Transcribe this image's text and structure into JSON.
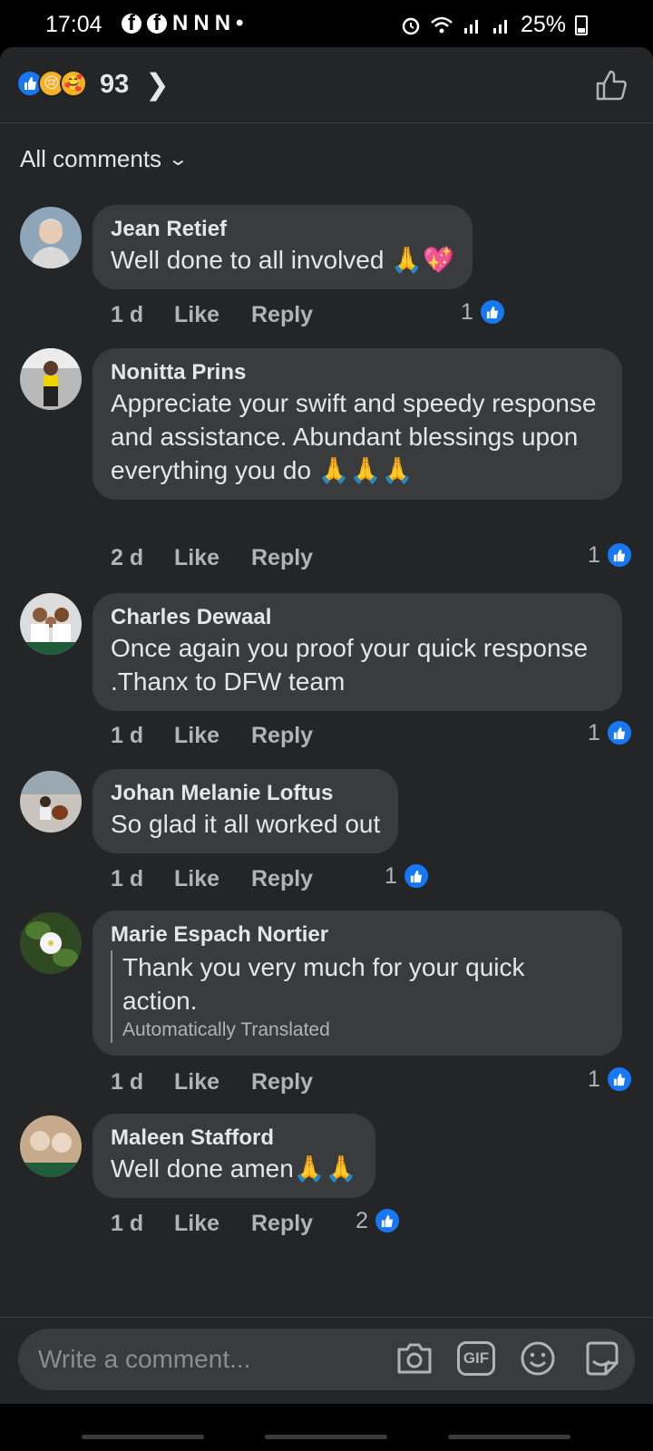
{
  "status_bar": {
    "time": "17:04",
    "notifications": [
      "f",
      "f",
      "N",
      "N",
      "N",
      "•"
    ],
    "battery": "25%"
  },
  "reactions": {
    "count": "93",
    "types": [
      "like-icon",
      "sad-icon",
      "care-icon"
    ]
  },
  "sort": {
    "label": "All comments"
  },
  "comments": [
    {
      "name": "Jean Retief",
      "text": "Well done to all involved 🙏💖",
      "time": "1 d",
      "like": "Like",
      "reply": "Reply",
      "reactions": "1"
    },
    {
      "name": "Nonitta Prins",
      "text": "Appreciate your swift and speedy response and assistance. Abundant blessings upon everything you do 🙏🙏🙏",
      "time": "2 d",
      "like": "Like",
      "reply": "Reply",
      "reactions": "1"
    },
    {
      "name": "Charles Dewaal",
      "text": "Once again you proof your quick response .Thanx to DFW team",
      "time": "1 d",
      "like": "Like",
      "reply": "Reply",
      "reactions": "1"
    },
    {
      "name": "Johan Melanie Loftus",
      "text": "So glad it all worked out",
      "time": "1 d",
      "like": "Like",
      "reply": "Reply",
      "reactions": "1"
    },
    {
      "name": "Marie Espach Nortier",
      "text": "Thank you very much for your quick action.",
      "translation_label": "Automatically Translated",
      "time": "1 d",
      "like": "Like",
      "reply": "Reply",
      "reactions": "1"
    },
    {
      "name": "Maleen Stafford",
      "text": "Well done amen🙏🙏",
      "time": "1 d",
      "like": "Like",
      "reply": "Reply",
      "reactions": "2"
    }
  ],
  "composer": {
    "placeholder": "Write a comment...",
    "gif_label": "GIF",
    "icons": [
      "camera-icon",
      "gif-icon",
      "emoji-icon",
      "sticker-icon"
    ]
  },
  "colors": {
    "background": "#242526",
    "bubble": "#3a3b3c",
    "accent": "#1877f2",
    "secondary_text": "#b0b3b8"
  }
}
